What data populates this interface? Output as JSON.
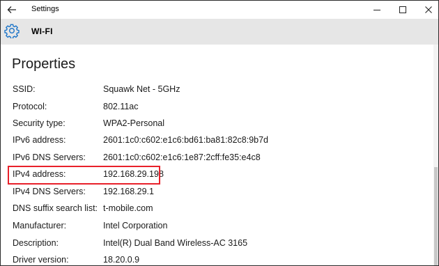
{
  "window": {
    "title": "Settings"
  },
  "header": {
    "title": "WI-FI",
    "icon": "gear-icon"
  },
  "main": {
    "section_title": "Properties",
    "properties": [
      {
        "label": "SSID:",
        "value": "Squawk Net - 5GHz"
      },
      {
        "label": "Protocol:",
        "value": "802.11ac"
      },
      {
        "label": "Security type:",
        "value": "WPA2-Personal"
      },
      {
        "label": "IPv6 address:",
        "value": "2601:1c0:c602:e1c6:bd61:ba81:82c8:9b7d"
      },
      {
        "label": "IPv6 DNS Servers:",
        "value": "2601:1c0:c602:e1c6:1e87:2cff:fe35:e4c8"
      },
      {
        "label": "IPv4 address:",
        "value": "192.168.29.198"
      },
      {
        "label": "IPv4 DNS Servers:",
        "value": "192.168.29.1"
      },
      {
        "label": "DNS suffix search list:",
        "value": "t-mobile.com"
      },
      {
        "label": "Manufacturer:",
        "value": "Intel Corporation"
      },
      {
        "label": "Description:",
        "value": "Intel(R) Dual Band Wireless-AC 3165"
      },
      {
        "label": "Driver version:",
        "value": "18.20.0.9"
      }
    ],
    "highlighted_index": 5
  },
  "colors": {
    "header_bg": "#e6e6e6",
    "accent": "#1a73c8",
    "highlight": "#e8202a"
  }
}
